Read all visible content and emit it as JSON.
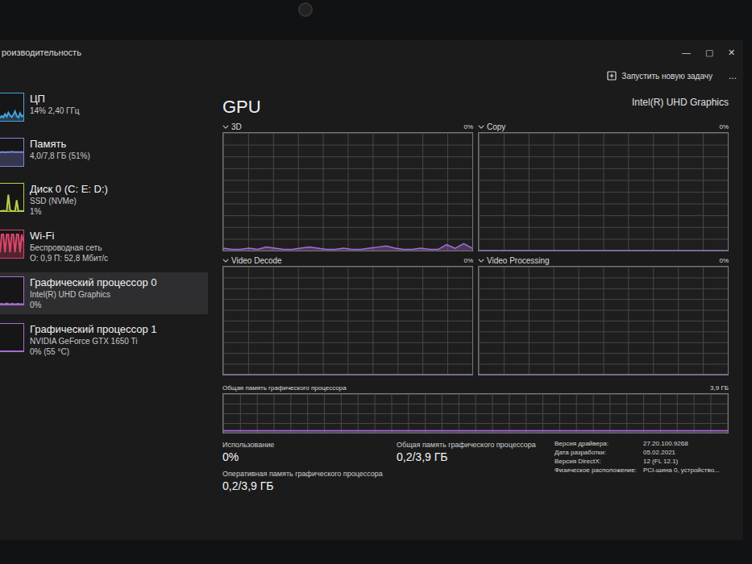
{
  "window": {
    "title": "роизводительность",
    "controls": [
      "—",
      "▢",
      "✕"
    ]
  },
  "toolbar": {
    "run_task": "Запустить новую задачу",
    "more": "..."
  },
  "sidebar": {
    "items": [
      {
        "name": "ЦП",
        "details": [
          "14% 2,40 ГГц"
        ],
        "selected": false,
        "color": "#4aa3df",
        "values": [
          10,
          18,
          12,
          25,
          15,
          30,
          20,
          14,
          22,
          35,
          18,
          12,
          28,
          16,
          20
        ]
      },
      {
        "name": "Память",
        "details": [
          "4,0/7,8 ГБ (51%)"
        ],
        "selected": false,
        "color": "#7f86d8",
        "values": [
          50,
          51,
          51,
          50,
          51,
          51,
          51,
          52,
          51,
          51,
          51,
          51,
          51,
          51,
          51
        ]
      },
      {
        "name": "Диск 0 (C: E: D:)",
        "details": [
          "SSD (NVMe)",
          "1%"
        ],
        "selected": false,
        "color": "#b5cf4a",
        "values": [
          0,
          0,
          2,
          0,
          0,
          60,
          5,
          0,
          0,
          0,
          40,
          0,
          0,
          1,
          0
        ]
      },
      {
        "name": "Wi-Fi",
        "details": [
          "Беспроводная сеть",
          "О: 0,9 П: 52,8 Мбит/с"
        ],
        "selected": false,
        "color": "#d9466b",
        "values": [
          20,
          85,
          85,
          20,
          85,
          85,
          20,
          85,
          85,
          20,
          85,
          85,
          20,
          85,
          60
        ]
      },
      {
        "name": "Графический процессор 0",
        "details": [
          "Intel(R) UHD Graphics",
          "0%"
        ],
        "selected": true,
        "color": "#a66cd1",
        "values": [
          2,
          3,
          1,
          2,
          4,
          2,
          1,
          3,
          2,
          1,
          2,
          3,
          1,
          2,
          1
        ]
      },
      {
        "name": "Графический процессор 1",
        "details": [
          "NVIDIA GeForce GTX 1650 Ti",
          "0% (55 °C)"
        ],
        "selected": false,
        "color": "#a66cd1",
        "values": [
          0,
          0,
          0,
          0,
          0,
          0,
          0,
          0,
          0,
          0,
          0,
          0,
          0,
          0,
          0
        ]
      }
    ]
  },
  "gpu": {
    "title": "GPU",
    "adapter": "Intel(R) UHD Graphics",
    "graphs": [
      {
        "label": "3D",
        "reading": "0%",
        "values": [
          2,
          1,
          1,
          2,
          1,
          3,
          2,
          1,
          1,
          2,
          3,
          2,
          1,
          1,
          2,
          1,
          1,
          2,
          3,
          4,
          2,
          1,
          1,
          2,
          1,
          1,
          5,
          2,
          6,
          2
        ]
      },
      {
        "label": "Copy",
        "reading": "0%",
        "values": [
          0,
          0,
          0,
          0,
          0,
          0,
          0,
          0,
          0,
          0,
          0,
          0,
          0,
          0,
          0,
          0,
          0,
          0,
          0,
          0
        ]
      },
      {
        "label": "Video Decode",
        "reading": "0%",
        "values": [
          0,
          0,
          0,
          0,
          0,
          0,
          0,
          0,
          0,
          0,
          0,
          0,
          0,
          0,
          0,
          0,
          0,
          0,
          0,
          0
        ]
      },
      {
        "label": "Video Processing",
        "reading": "0%",
        "values": [
          0,
          0,
          0,
          0,
          0,
          0,
          0,
          0,
          0,
          0,
          0,
          0,
          0,
          0,
          0,
          0,
          0,
          0,
          0,
          0
        ]
      }
    ],
    "shared_memory_graph": {
      "label": "Общая память графического процессора",
      "max": "3,9 ГБ",
      "axis_max": 3.9,
      "values": [
        0.2,
        0.2,
        0.2,
        0.2,
        0.2,
        0.2,
        0.2,
        0.2,
        0.2,
        0.2
      ]
    },
    "stats_left": [
      {
        "label": "Использование",
        "value": "0%"
      },
      {
        "label": "Оперативная память графического процессора",
        "value": "0,2/3,9 ГБ"
      }
    ],
    "stats_mid": [
      {
        "label": "Общая память графического процессора",
        "value": "0,2/3,9 ГБ"
      }
    ],
    "details": [
      {
        "label": "Версия драйвера:",
        "value": "27.20.100.9268"
      },
      {
        "label": "Дата разработки:",
        "value": "05.02.2021"
      },
      {
        "label": "Версия DirectX:",
        "value": "12 (FL 12.1)"
      },
      {
        "label": "Физическое расположение:",
        "value": "PCI-шина 0, устройство..."
      }
    ]
  }
}
